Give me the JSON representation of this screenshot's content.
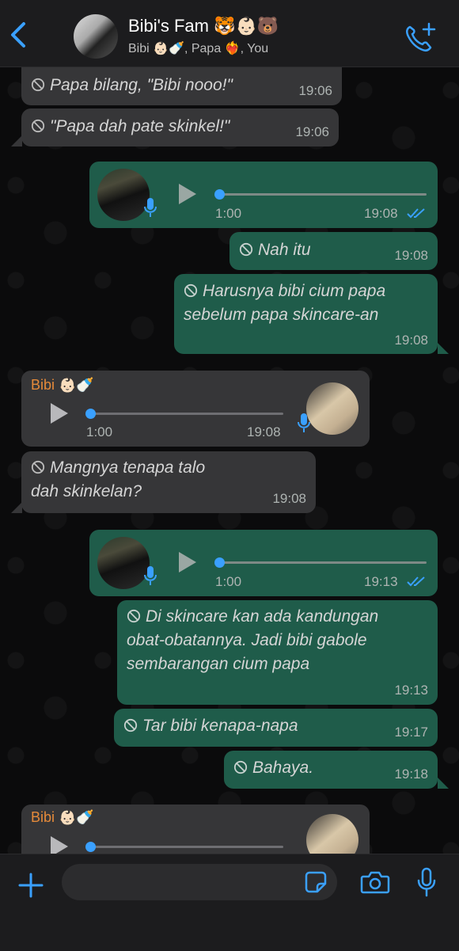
{
  "header": {
    "title": "Bibi's Fam 🐯👶🏻🐻",
    "subtitle": "Bibi 👶🏻🍼, Papa ❤️‍🔥, You"
  },
  "messages": [
    {
      "text": "Papa bilang, \"Bibi nooo!\"",
      "time": "19:06"
    },
    {
      "text": "\"Papa dah pate skinkel!\"",
      "time": "19:06"
    },
    {
      "duration": "1:00",
      "time": "19:08"
    },
    {
      "text": "Nah itu",
      "time": "19:08"
    },
    {
      "line1": "Harusnya bibi cium papa",
      "line2": "sebelum papa skincare-an",
      "time": "19:08"
    },
    {
      "sender": "Bibi 👶🏻🍼",
      "duration": "1:00",
      "time": "19:08"
    },
    {
      "line1": "Mangnya tenapa talo",
      "line2": "dah skinkelan?",
      "time": "19:08"
    },
    {
      "duration": "1:00",
      "time": "19:13"
    },
    {
      "line1": "Di skincare kan ada kandungan",
      "line2": "obat-obatannya. Jadi bibi gabole",
      "line3": "sembarangan cium papa",
      "time": "19:13"
    },
    {
      "text": "Tar bibi kenapa-napa",
      "time": "19:17"
    },
    {
      "text": "Bahaya.",
      "time": "19:18"
    },
    {
      "sender": "Bibi 👶🏻🍼"
    }
  ],
  "input": {
    "placeholder": ""
  },
  "icons": [
    "back-chevron-icon",
    "add-call-icon",
    "deleted-icon",
    "play-icon",
    "mic-icon",
    "double-check-icon",
    "plus-icon",
    "sticker-icon",
    "camera-icon",
    "microphone-icon"
  ],
  "colors": {
    "accent": "#3aa0ff",
    "outgoing": "#1f5c4a",
    "incoming": "#363638",
    "sender": "#e58a3a"
  }
}
